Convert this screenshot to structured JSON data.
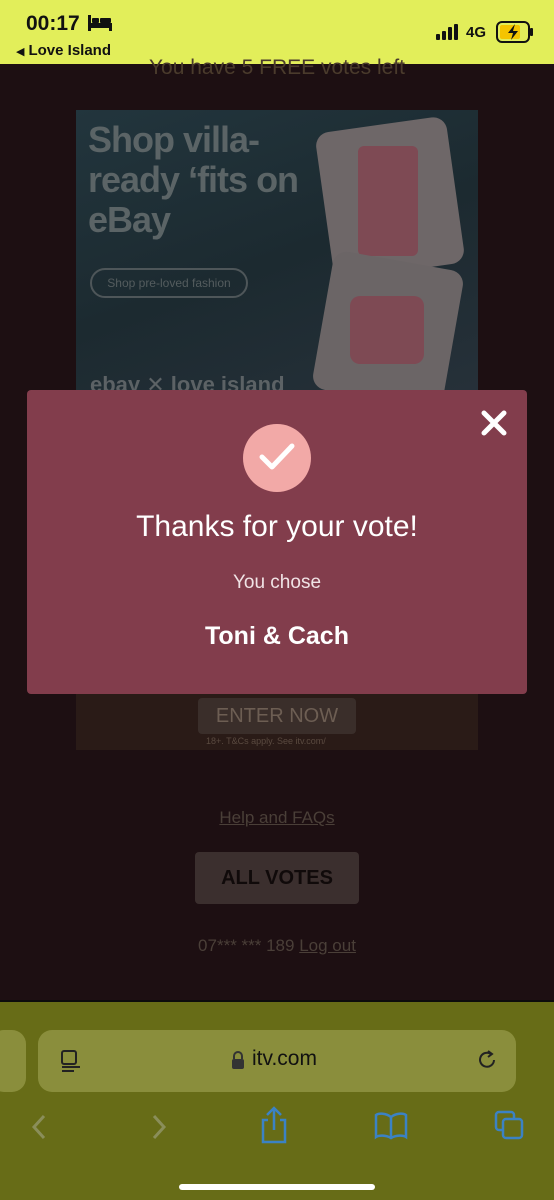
{
  "status_bar": {
    "time": "00:17",
    "back_app": "Love Island",
    "network": "4G",
    "icons": [
      "bed-icon",
      "signal-icon",
      "battery-charging-icon"
    ]
  },
  "page": {
    "free_votes_text": "You have 5 FREE votes left",
    "ad_top": {
      "headline": "Shop villa-ready ‘fits on eBay",
      "button": "Shop pre-loved fashion",
      "logos": "ebay ✕ love island"
    },
    "ad_bottom": {
      "button": "ENTER NOW",
      "terms": "18+. T&Cs apply. See itv.com/"
    },
    "help_link": "Help and FAQs",
    "all_votes_button": "ALL VOTES",
    "account_number": "07*** *** 189",
    "logout_link": "Log out"
  },
  "modal": {
    "title": "Thanks for your vote!",
    "subtitle": "You chose",
    "choice": "Toni & Cach",
    "background_color": "#823d4c",
    "check_circle_color": "#f2a9a7"
  },
  "browser": {
    "url": "itv.com",
    "toolbar_icons": [
      "back-icon",
      "forward-icon",
      "share-icon",
      "bookmarks-icon",
      "tabs-icon"
    ]
  }
}
